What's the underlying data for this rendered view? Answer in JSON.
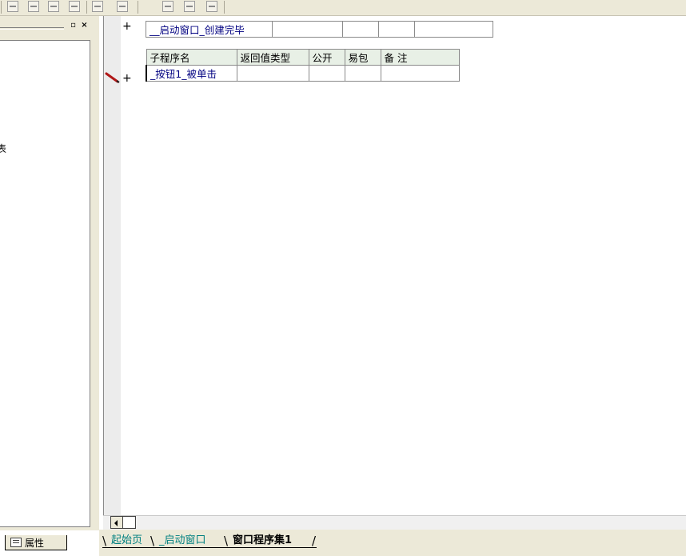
{
  "toolbar": {
    "icons": [
      "align-left-icon",
      "align-center-icon",
      "align-top-icon",
      "align-right-icon",
      "same-width-icon",
      "same-height-icon",
      "space-horizontal-icon",
      "space-vertical-icon",
      "center-icon"
    ]
  },
  "left_pane": {
    "tree_fragment": "表",
    "restore_glyph": "▫",
    "close_glyph": "×"
  },
  "property_tab": {
    "label": "属性"
  },
  "editor": {
    "top_row": {
      "name": "__启动窗口_创建完毕",
      "plus": "+"
    },
    "sub_table": {
      "headers": [
        "子程序名",
        "返回值类型",
        "公开",
        "易包",
        "备 注"
      ],
      "row": [
        "_按钮1_被单击",
        "",
        "",
        "",
        ""
      ],
      "plus": "+"
    }
  },
  "tabs": {
    "items": [
      {
        "label": "起始页"
      },
      {
        "label": "_启动窗口"
      },
      {
        "label": "窗口程序集1"
      }
    ],
    "slash": "\\",
    "slash_end": "/"
  },
  "scrollbar": {
    "left_arrow": "◄"
  },
  "colors": {
    "chrome": "#ece9d8",
    "identifier_blue": "#000080",
    "tab_teal": "#008080",
    "header_bg": "#e8f0e6",
    "pencil_red": "#b01818"
  }
}
